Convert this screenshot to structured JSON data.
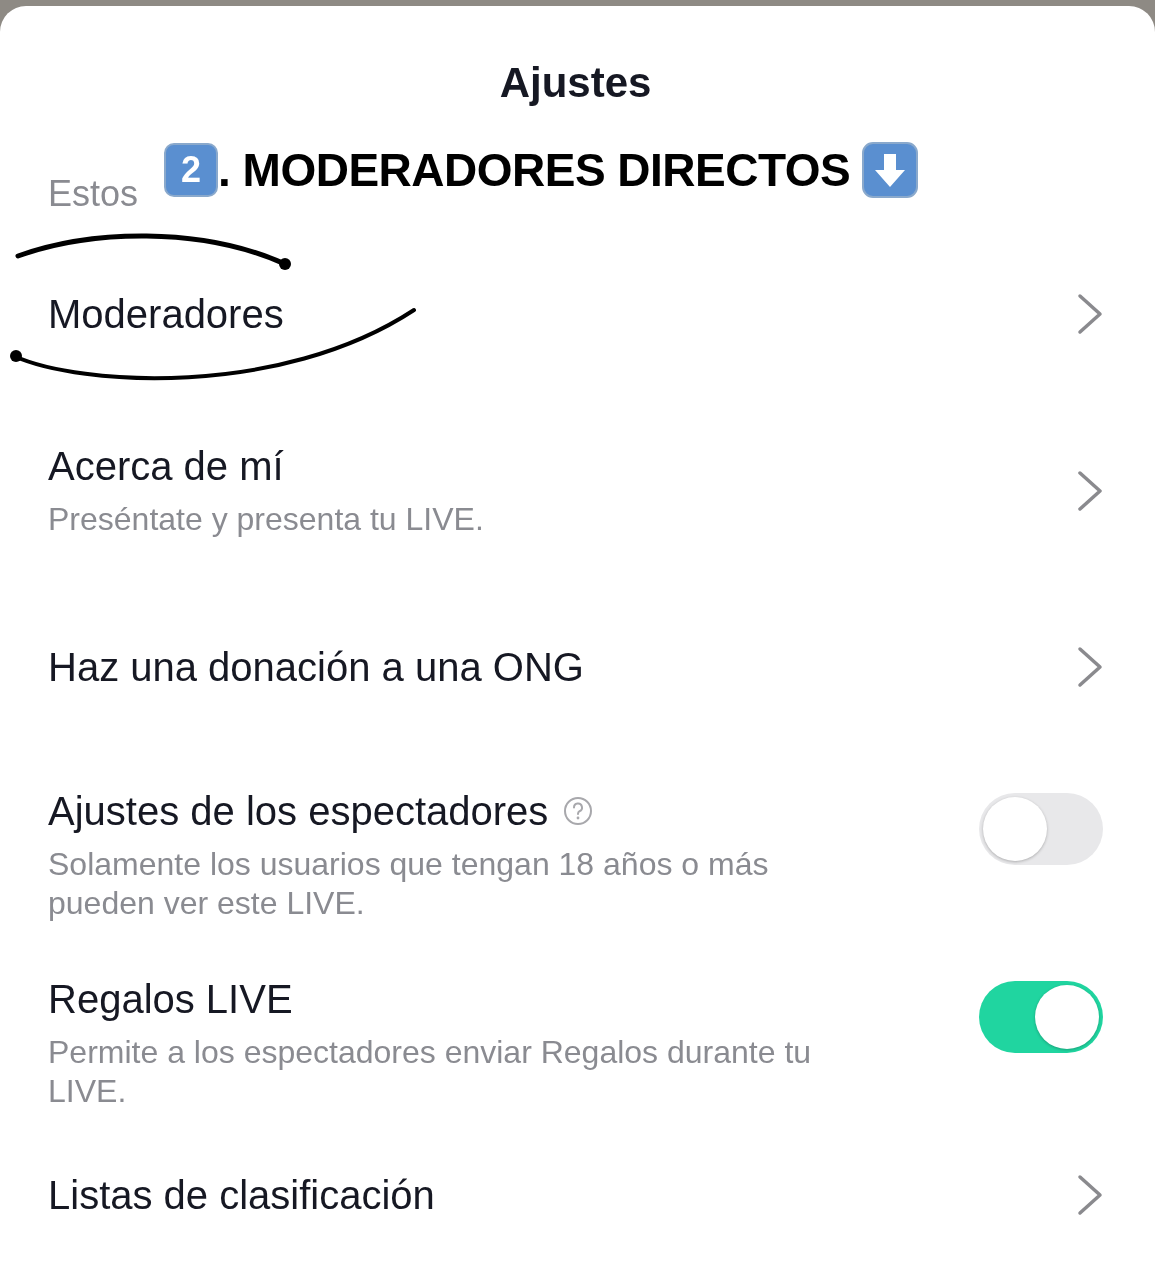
{
  "title": "Ajustes",
  "annotation": {
    "badge": "2",
    "text": ". MODERADORES DIRECTOS"
  },
  "section_hint": "Estos",
  "rows": [
    {
      "kind": "link",
      "label": "Moderadores",
      "help": false
    },
    {
      "kind": "link",
      "label": "Acerca de mí",
      "help": false,
      "description": "Preséntate y presenta tu LIVE."
    },
    {
      "kind": "link",
      "label": "Haz una donación a una ONG",
      "help": false
    },
    {
      "kind": "toggle",
      "label": "Ajustes de los espectadores",
      "help": true,
      "description": "Solamente los usuarios que tengan 18 años o más pueden ver este LIVE.",
      "on": false
    },
    {
      "kind": "toggle",
      "label": "Regalos LIVE",
      "help": false,
      "description": "Permite a los espectadores enviar Regalos durante tu LIVE.",
      "on": true
    },
    {
      "kind": "link",
      "label": "Listas de clasificación",
      "help": false
    }
  ]
}
